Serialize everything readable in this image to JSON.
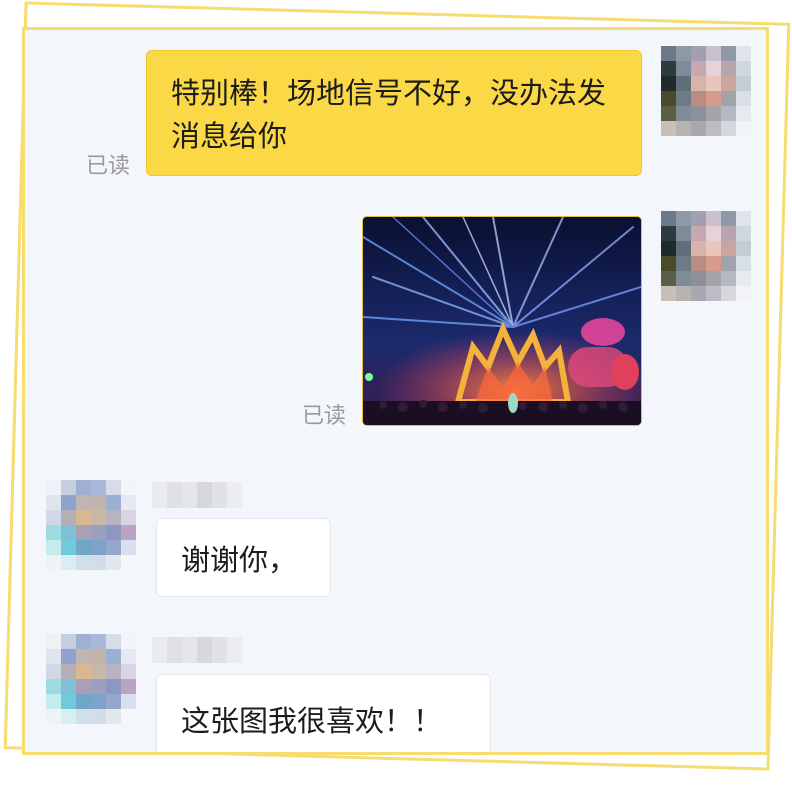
{
  "chat": {
    "messages": [
      {
        "direction": "outgoing",
        "type": "text",
        "text": "特别棒！场地信号不好，没办法发消息给你",
        "status": "已读"
      },
      {
        "direction": "outgoing",
        "type": "image",
        "image_subject": "concert stage with lights",
        "status": "已读"
      },
      {
        "direction": "incoming",
        "type": "text",
        "text": "谢谢你，"
      },
      {
        "direction": "incoming",
        "type": "text",
        "text": "这张图我很喜欢！！"
      }
    ]
  },
  "colors": {
    "outgoing_bubble": "#fbd845",
    "incoming_bubble": "#ffffff",
    "chat_background": "#f3f6fa",
    "frame_border": "#f7dc6f",
    "read_status_text": "#9a9a9a"
  },
  "icons": {
    "self_avatar": "pixelated-avatar-icon",
    "other_avatar": "pixelated-avatar-icon"
  }
}
